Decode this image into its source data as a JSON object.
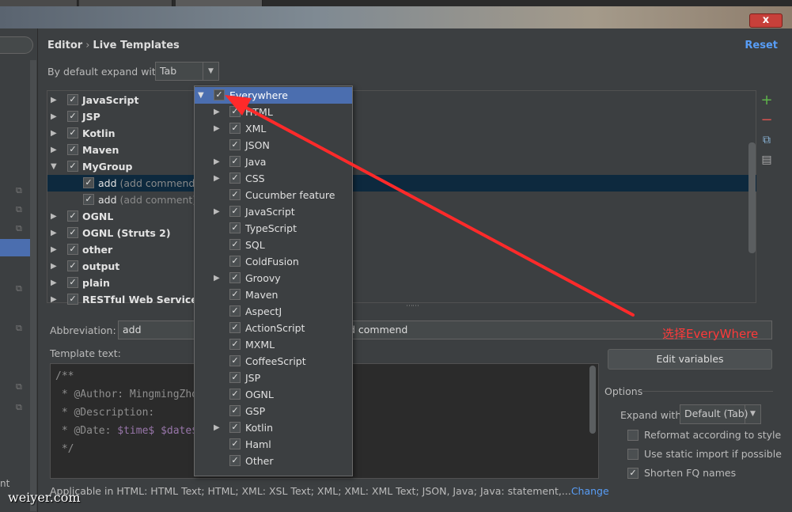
{
  "colors": {
    "accent": "#589df6",
    "selection": "#4b6eaf",
    "annotation": "#ff3a3a",
    "background": "#3c3f41"
  },
  "window": {
    "close_label": "x"
  },
  "sidebar": {
    "bottom_text": "nt"
  },
  "header": {
    "breadcrumb_section": "Editor",
    "breadcrumb_page": "Live Templates",
    "reset_label": "Reset"
  },
  "expand": {
    "label": "By default expand with",
    "value": "Tab"
  },
  "tree": {
    "groups": [
      {
        "name": "JavaScript",
        "expanded": false
      },
      {
        "name": "JSP",
        "expanded": false
      },
      {
        "name": "Kotlin",
        "expanded": false
      },
      {
        "name": "Maven",
        "expanded": false
      },
      {
        "name": "MyGroup",
        "expanded": true
      },
      {
        "name": "add",
        "desc": "(add commend)",
        "child": true,
        "selected": true
      },
      {
        "name": "add",
        "desc": "(add comment)",
        "child": true
      },
      {
        "name": "OGNL",
        "expanded": false
      },
      {
        "name": "OGNL (Struts 2)",
        "expanded": false
      },
      {
        "name": "other",
        "expanded": false
      },
      {
        "name": "output",
        "expanded": false
      },
      {
        "name": "plain",
        "expanded": false
      },
      {
        "name": "RESTful Web Services",
        "expanded": false
      }
    ]
  },
  "toolbar": {
    "add_icon": "plus-icon",
    "remove_icon": "minus-icon",
    "copy_icon": "copy-icon",
    "edit_icon": "edit-icon"
  },
  "abbreviation": {
    "label": "Abbreviation:",
    "value": "add",
    "description_visible": "d commend"
  },
  "template_text": {
    "label": "Template text:",
    "lines": [
      [
        "/**"
      ],
      [
        " * @Author: MingmingZho"
      ],
      [
        " * @Description:"
      ],
      [
        " * @Date: ",
        "$time$",
        " ",
        "$date$"
      ],
      [
        " */"
      ]
    ]
  },
  "annotation": {
    "text": "选择EveryWhere"
  },
  "options": {
    "edit_variables_label": "Edit variables",
    "title": "Options",
    "expand_label": "Expand with",
    "expand_value": "Default (Tab)",
    "reformat": {
      "label": "Reformat according to style",
      "checked": false
    },
    "static_import": {
      "label": "Use static import if possible",
      "checked": false
    },
    "shorten_fq": {
      "label": "Shorten FQ names",
      "checked": true
    }
  },
  "applicable": {
    "text": "Applicable in HTML: HTML Text; HTML; XML: XSL Text; XML; XML: XML Text; JSON, Java; Java: statement,...",
    "change_label": "Change"
  },
  "watermark": "weiyer.com",
  "contexts": [
    {
      "label": "Everywhere",
      "expandable": true,
      "selected": true
    },
    {
      "label": "HTML",
      "expandable": true
    },
    {
      "label": "XML",
      "expandable": true
    },
    {
      "label": "JSON",
      "expandable": false
    },
    {
      "label": "Java",
      "expandable": true
    },
    {
      "label": "CSS",
      "expandable": true
    },
    {
      "label": "Cucumber feature",
      "expandable": false
    },
    {
      "label": "JavaScript",
      "expandable": true
    },
    {
      "label": "TypeScript",
      "expandable": false
    },
    {
      "label": "SQL",
      "expandable": false
    },
    {
      "label": "ColdFusion",
      "expandable": false
    },
    {
      "label": "Groovy",
      "expandable": true
    },
    {
      "label": "Maven",
      "expandable": false
    },
    {
      "label": "AspectJ",
      "expandable": false
    },
    {
      "label": "ActionScript",
      "expandable": false
    },
    {
      "label": "MXML",
      "expandable": false
    },
    {
      "label": "CoffeeScript",
      "expandable": false
    },
    {
      "label": "JSP",
      "expandable": false
    },
    {
      "label": "OGNL",
      "expandable": false
    },
    {
      "label": "GSP",
      "expandable": false
    },
    {
      "label": "Kotlin",
      "expandable": true
    },
    {
      "label": "Haml",
      "expandable": false
    },
    {
      "label": "Other",
      "expandable": false
    }
  ]
}
